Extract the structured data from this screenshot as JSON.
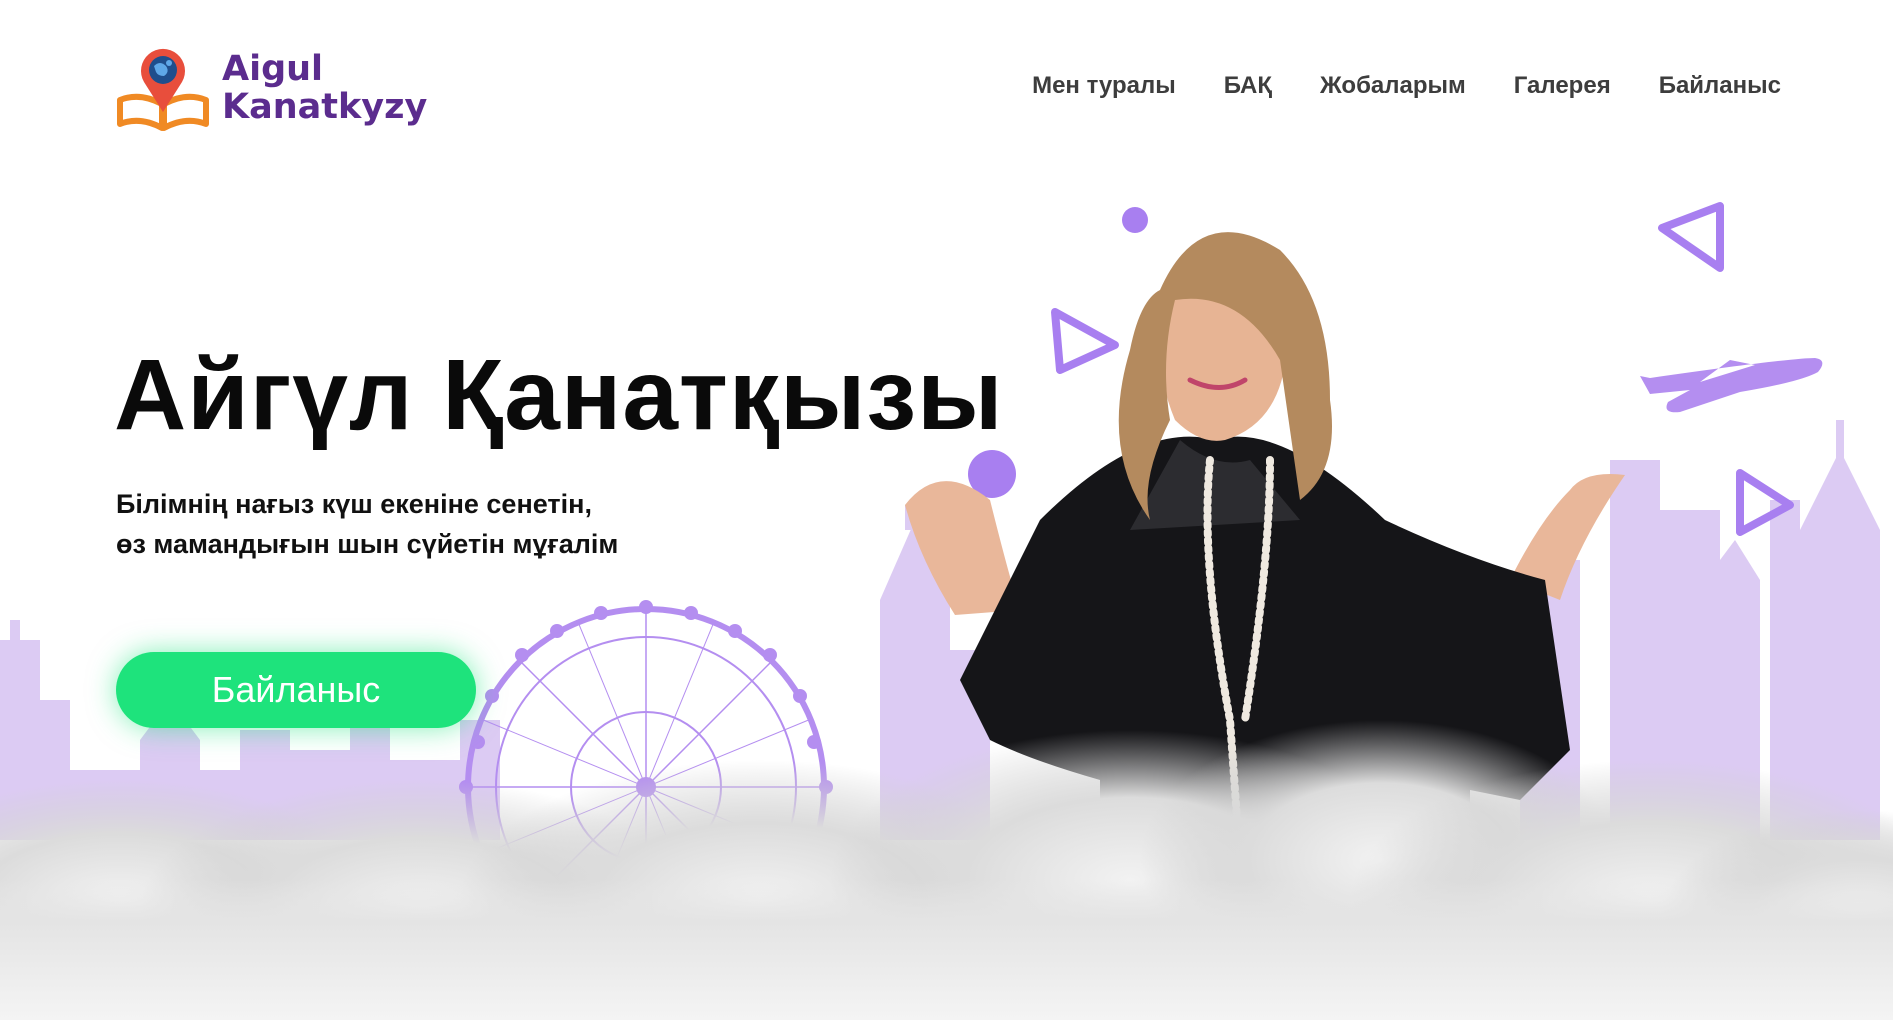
{
  "logo": {
    "line1": "Aigul",
    "line2": "Kanatkyzy",
    "icon": "book-globe-pin-icon"
  },
  "nav": {
    "items": [
      "Мен туралы",
      "БАҚ",
      "Жобаларым",
      "Галерея",
      "Байланыс"
    ]
  },
  "hero": {
    "title": "Айгүл Қанатқызы",
    "subtitle_line1": "Білімнің нағыз күш екеніне сенетін,",
    "subtitle_line2": "өз мамандығын шын сүйетін мұғалім",
    "cta_label": "Байланыс"
  },
  "colors": {
    "accent_purple": "#a87ff0",
    "skyline": "#dccbf3",
    "cta_green": "#1ee37c",
    "logo_text": "#5b2c8e",
    "logo_orange": "#f08a24"
  },
  "decor": [
    "circle-icon",
    "triangle-outline-icon",
    "airplane-icon",
    "ferris-wheel-icon",
    "city-skyline",
    "clouds",
    "person-photo"
  ]
}
